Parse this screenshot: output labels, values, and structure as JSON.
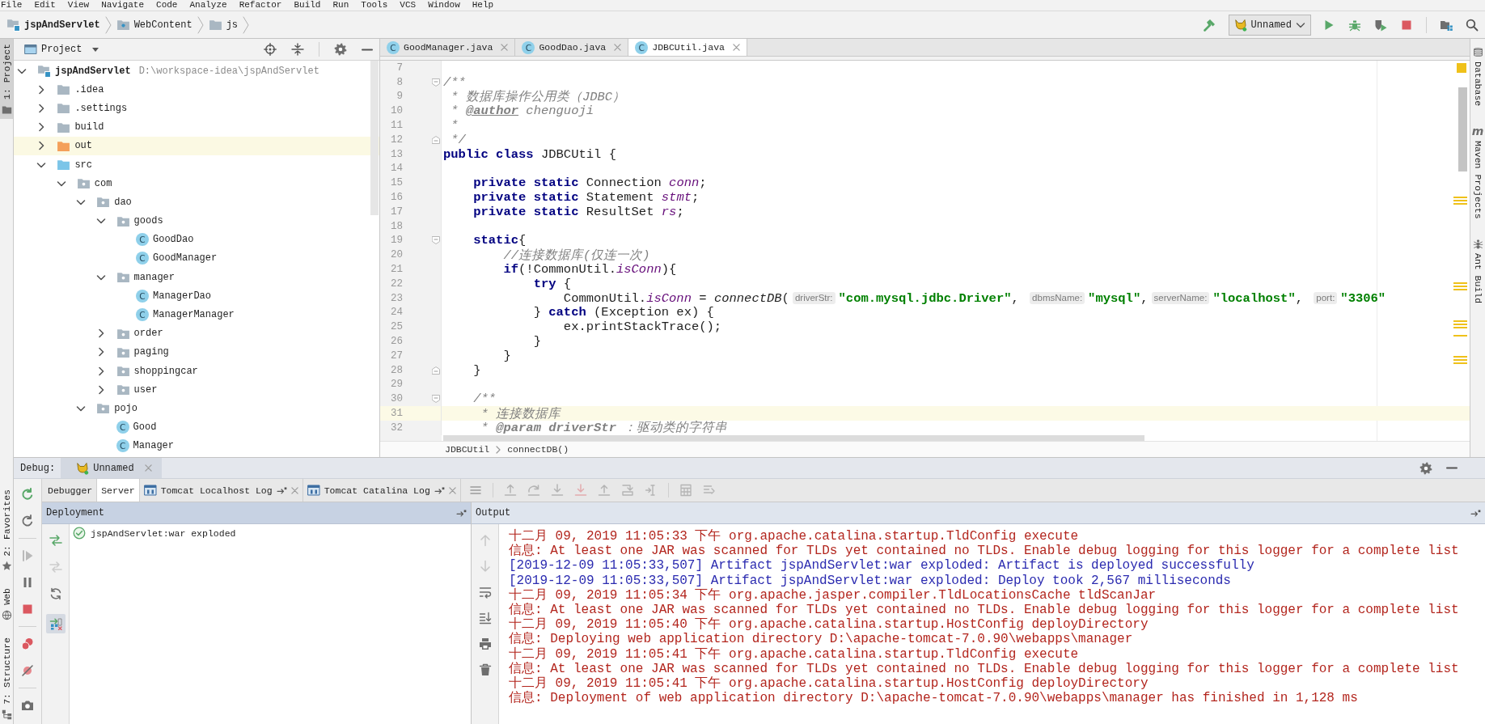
{
  "menu_bar": [
    "File",
    "Edit",
    "View",
    "Navigate",
    "Code",
    "Analyze",
    "Refactor",
    "Build",
    "Run",
    "Tools",
    "VCS",
    "Window",
    "Help"
  ],
  "nav_bar": {
    "breadcrumbs": [
      {
        "label": "jspAndServlet",
        "kind": "module"
      },
      {
        "label": "WebContent",
        "kind": "web_folder"
      },
      {
        "label": "js",
        "kind": "folder"
      }
    ],
    "run_config": {
      "label": "Unnamed"
    }
  },
  "left_tool_strip": {
    "top": [
      {
        "label": "1: Project",
        "kind": "project",
        "selected": true
      }
    ],
    "bottom": [
      {
        "label": "2: Favorites",
        "kind": "favorites",
        "selected": false
      },
      {
        "label": "Web",
        "kind": "web",
        "selected": false
      },
      {
        "label": "7: Structure",
        "kind": "structure",
        "selected": false
      }
    ]
  },
  "project": {
    "title": "Project",
    "tree": [
      {
        "label": "jspAndServlet",
        "location": "D:\\workspace-idea\\jspAndServlet",
        "kind": "module",
        "expanded": true,
        "selected": false,
        "children": [
          {
            "label": ".idea",
            "kind": "folder",
            "expanded": false,
            "selected": false
          },
          {
            "label": ".settings",
            "kind": "folder",
            "expanded": false,
            "selected": false
          },
          {
            "label": "build",
            "kind": "folder",
            "expanded": false,
            "selected": false
          },
          {
            "label": "out",
            "kind": "excluded_folder",
            "expanded": false,
            "selected": true
          },
          {
            "label": "src",
            "kind": "source_folder",
            "expanded": true,
            "selected": false,
            "children": [
              {
                "label": "com",
                "kind": "package",
                "expanded": true,
                "selected": false,
                "children": [
                  {
                    "label": "dao",
                    "kind": "package",
                    "expanded": true,
                    "selected": false,
                    "children": [
                      {
                        "label": "goods",
                        "kind": "package",
                        "expanded": true,
                        "selected": false,
                        "children": [
                          {
                            "label": "GoodDao",
                            "kind": "class",
                            "icon_letter": "C",
                            "expanded": false,
                            "selected": false
                          },
                          {
                            "label": "GoodManager",
                            "kind": "class",
                            "icon_letter": "C",
                            "expanded": false,
                            "selected": false
                          }
                        ]
                      },
                      {
                        "label": "manager",
                        "kind": "package",
                        "expanded": true,
                        "selected": false,
                        "children": [
                          {
                            "label": "ManagerDao",
                            "kind": "class",
                            "icon_letter": "C",
                            "expanded": false,
                            "selected": false
                          },
                          {
                            "label": "ManagerManager",
                            "kind": "class",
                            "icon_letter": "C",
                            "expanded": false,
                            "selected": false
                          }
                        ]
                      },
                      {
                        "label": "order",
                        "kind": "package",
                        "expanded": false,
                        "selected": false
                      },
                      {
                        "label": "paging",
                        "kind": "package",
                        "expanded": false,
                        "selected": false
                      },
                      {
                        "label": "shoppingcar",
                        "kind": "package",
                        "expanded": false,
                        "selected": false
                      },
                      {
                        "label": "user",
                        "kind": "package",
                        "expanded": false,
                        "selected": false
                      }
                    ]
                  },
                  {
                    "label": "pojo",
                    "kind": "package",
                    "expanded": true,
                    "selected": false,
                    "children": [
                      {
                        "label": "Good",
                        "kind": "class",
                        "icon_letter": "C",
                        "expanded": false,
                        "selected": false
                      },
                      {
                        "label": "Manager",
                        "kind": "class",
                        "icon_letter": "C",
                        "expanded": false,
                        "selected": false
                      }
                    ]
                  }
                ]
              }
            ]
          }
        ]
      }
    ]
  },
  "editor": {
    "tabs": [
      {
        "label": "GoodManager.java",
        "icon_letter": "C",
        "selected": false
      },
      {
        "label": "GoodDao.java",
        "icon_letter": "C",
        "selected": false
      },
      {
        "label": "JDBCUtil.java",
        "icon_letter": "C",
        "selected": true
      }
    ],
    "lines": [
      {
        "number": "7",
        "kind": "plain",
        "current": false
      },
      {
        "number": "8",
        "kind": "fold_start",
        "current": false,
        "tokens": [
          {
            "kind": "doc",
            "text": "/**"
          }
        ]
      },
      {
        "number": "9",
        "kind": "plain",
        "current": false,
        "tokens": [
          {
            "kind": "doc",
            "text": " * 数据库操作公用类（JDBC）"
          }
        ]
      },
      {
        "number": "10",
        "kind": "plain",
        "current": false,
        "tokens": [
          {
            "kind": "doc",
            "text": " * "
          },
          {
            "kind": "doc_tag",
            "text": "@author"
          },
          {
            "kind": "doc",
            "text": " chenguoji"
          }
        ]
      },
      {
        "number": "11",
        "kind": "plain",
        "current": false,
        "tokens": [
          {
            "kind": "doc",
            "text": " *"
          }
        ]
      },
      {
        "number": "12",
        "kind": "fold_end",
        "current": false,
        "tokens": [
          {
            "kind": "doc",
            "text": " */"
          }
        ]
      },
      {
        "number": "13",
        "kind": "plain",
        "current": false,
        "tokens": [
          {
            "kind": "keyword",
            "text": "public class"
          },
          {
            "kind": "plain",
            "text": " JDBCUtil {"
          }
        ]
      },
      {
        "number": "14",
        "kind": "plain",
        "current": false
      },
      {
        "number": "15",
        "kind": "plain",
        "current": false,
        "tokens": [
          {
            "kind": "keyword",
            "text": "    private static"
          },
          {
            "kind": "plain",
            "text": " Connection "
          },
          {
            "kind": "field",
            "text": "conn"
          },
          {
            "kind": "plain",
            "text": ";"
          }
        ]
      },
      {
        "number": "16",
        "kind": "plain",
        "current": false,
        "tokens": [
          {
            "kind": "keyword",
            "text": "    private static"
          },
          {
            "kind": "plain",
            "text": " Statement "
          },
          {
            "kind": "field",
            "text": "stmt"
          },
          {
            "kind": "plain",
            "text": ";"
          }
        ]
      },
      {
        "number": "17",
        "kind": "plain",
        "current": false,
        "tokens": [
          {
            "kind": "keyword",
            "text": "    private static"
          },
          {
            "kind": "plain",
            "text": " ResultSet "
          },
          {
            "kind": "field",
            "text": "rs"
          },
          {
            "kind": "plain",
            "text": ";"
          }
        ]
      },
      {
        "number": "18",
        "kind": "plain",
        "current": false
      },
      {
        "number": "19",
        "kind": "fold_start",
        "current": false,
        "tokens": [
          {
            "kind": "keyword",
            "text": "    static"
          },
          {
            "kind": "plain",
            "text": "{"
          }
        ]
      },
      {
        "number": "20",
        "kind": "plain",
        "current": false,
        "tokens": [
          {
            "kind": "comment",
            "text": "        //连接数据库(仅连一次)"
          }
        ]
      },
      {
        "number": "21",
        "kind": "plain",
        "current": false,
        "tokens": [
          {
            "kind": "keyword",
            "text": "        if"
          },
          {
            "kind": "plain",
            "text": "(!CommonUtil."
          },
          {
            "kind": "field",
            "text": "isConn"
          },
          {
            "kind": "plain",
            "text": "){"
          }
        ]
      },
      {
        "number": "22",
        "kind": "plain",
        "current": false,
        "tokens": [
          {
            "kind": "keyword",
            "text": "            try"
          },
          {
            "kind": "plain",
            "text": " {"
          }
        ]
      },
      {
        "number": "23",
        "kind": "plain",
        "current": false,
        "tokens": [
          {
            "kind": "plain",
            "text": "                CommonUtil."
          },
          {
            "kind": "field",
            "text": "isConn"
          },
          {
            "kind": "plain",
            "text": " = "
          },
          {
            "kind": "method",
            "text": "connectDB"
          },
          {
            "kind": "plain",
            "text": "("
          },
          {
            "kind": "hint",
            "text": "driverStr:"
          },
          {
            "kind": "string",
            "text": "\"com.mysql.jdbc.Driver\""
          },
          {
            "kind": "plain",
            "text": ", "
          },
          {
            "kind": "hint",
            "text": "dbmsName:"
          },
          {
            "kind": "string",
            "text": "\"mysql\""
          },
          {
            "kind": "plain",
            "text": ","
          },
          {
            "kind": "hint",
            "text": "serverName:"
          },
          {
            "kind": "string",
            "text": "\"localhost\""
          },
          {
            "kind": "plain",
            "text": ", "
          },
          {
            "kind": "hint",
            "text": "port:"
          },
          {
            "kind": "string",
            "text": "\"3306\""
          }
        ]
      },
      {
        "number": "24",
        "kind": "plain",
        "current": false,
        "tokens": [
          {
            "kind": "plain",
            "text": "            } "
          },
          {
            "kind": "keyword",
            "text": "catch"
          },
          {
            "kind": "plain",
            "text": " (Exception ex) {"
          }
        ]
      },
      {
        "number": "25",
        "kind": "plain",
        "current": false,
        "tokens": [
          {
            "kind": "plain",
            "text": "                ex.printStackTrace();"
          }
        ]
      },
      {
        "number": "26",
        "kind": "plain",
        "current": false,
        "tokens": [
          {
            "kind": "plain",
            "text": "            }"
          }
        ]
      },
      {
        "number": "27",
        "kind": "plain",
        "current": false,
        "tokens": [
          {
            "kind": "plain",
            "text": "        }"
          }
        ]
      },
      {
        "number": "28",
        "kind": "fold_end",
        "current": false,
        "tokens": [
          {
            "kind": "plain",
            "text": "    }"
          }
        ]
      },
      {
        "number": "29",
        "kind": "plain",
        "current": false
      },
      {
        "number": "30",
        "kind": "fold_start",
        "current": false,
        "tokens": [
          {
            "kind": "doc",
            "text": "    /**"
          }
        ]
      },
      {
        "number": "31",
        "kind": "plain",
        "current": true,
        "tokens": [
          {
            "kind": "doc",
            "text": "     * 连接数据库"
          }
        ]
      },
      {
        "number": "32",
        "kind": "plain",
        "current": false,
        "tokens": [
          {
            "kind": "doc",
            "text": "     * "
          },
          {
            "kind": "doc_param",
            "text": "@param driverStr"
          },
          {
            "kind": "doc",
            "text": " ：驱动类的字符串"
          }
        ]
      }
    ],
    "breadcrumbs": [
      "JDBCUtil",
      "connectDB()"
    ]
  },
  "right_tool_strip": [
    {
      "label": "Database",
      "kind": "database"
    },
    {
      "label": "Maven Projects",
      "kind": "maven",
      "icon_letter": "m"
    },
    {
      "label": "Ant Build",
      "kind": "ant"
    }
  ],
  "debug": {
    "title": "Debug:",
    "session": {
      "label": "Unnamed"
    },
    "actions": [
      [
        {
          "kind": "rerun",
          "disabled": false
        },
        {
          "kind": "update",
          "disabled": false
        }
      ],
      [
        {
          "kind": "resume",
          "disabled": true
        },
        {
          "kind": "pause",
          "disabled": false
        },
        {
          "kind": "stop",
          "disabled": false
        }
      ],
      [
        {
          "kind": "breakpoints",
          "disabled": false
        },
        {
          "kind": "mute",
          "disabled": false
        }
      ],
      [
        {
          "kind": "camera",
          "disabled": false
        }
      ]
    ],
    "tabs": [
      {
        "label": "Debugger",
        "kind": "view",
        "selected": false
      },
      {
        "label": "Server",
        "kind": "view",
        "selected": true
      },
      {
        "label": "Tomcat Localhost Log",
        "kind": "log",
        "selected": false
      },
      {
        "label": "Tomcat Catalina Log",
        "kind": "log",
        "selected": false
      }
    ],
    "toolbar": [
      [
        {
          "kind": "menu",
          "disabled": false
        }
      ],
      [
        {
          "kind": "execpoint",
          "disabled": true
        },
        {
          "kind": "stepover",
          "disabled": true
        },
        {
          "kind": "stepinto",
          "disabled": true
        },
        {
          "kind": "forcestepinto",
          "disabled": true
        },
        {
          "kind": "stepout",
          "disabled": true
        },
        {
          "kind": "dropframe",
          "disabled": true
        },
        {
          "kind": "runtocursor",
          "disabled": true
        }
      ],
      [
        {
          "kind": "evaluate",
          "disabled": true
        },
        {
          "kind": "trace",
          "disabled": true
        }
      ]
    ],
    "deployment": {
      "title": "Deployment",
      "tools": [
        {
          "kind": "deploy",
          "disabled": false,
          "pressed": false
        },
        {
          "kind": "undeploy",
          "disabled": true,
          "pressed": false
        },
        {
          "kind": "refresh",
          "disabled": false,
          "pressed": false
        },
        {
          "kind": "artifacts",
          "disabled": false,
          "pressed": true
        }
      ],
      "items": [
        {
          "label": "jspAndServlet:war exploded",
          "kind": "deployed"
        }
      ]
    },
    "output": {
      "title": "Output",
      "tools": [
        {
          "kind": "up",
          "disabled": true
        },
        {
          "kind": "down",
          "disabled": true
        },
        {
          "kind": "wrap",
          "disabled": false
        },
        {
          "kind": "autoscroll",
          "disabled": false
        },
        {
          "kind": "print",
          "disabled": false
        },
        {
          "kind": "trash",
          "disabled": false
        }
      ],
      "lines": [
        {
          "kind": "stderr",
          "text": "十二月 09, 2019 11:05:33 下午 org.apache.catalina.startup.TldConfig execute"
        },
        {
          "kind": "stderr",
          "text": "信息: At least one JAR was scanned for TLDs yet contained no TLDs. Enable debug logging for this logger for a complete list"
        },
        {
          "kind": "stdout",
          "text": "[2019-12-09 11:05:33,507] Artifact jspAndServlet:war exploded: Artifact is deployed successfully"
        },
        {
          "kind": "stdout",
          "text": "[2019-12-09 11:05:33,507] Artifact jspAndServlet:war exploded: Deploy took 2,567 milliseconds"
        },
        {
          "kind": "stderr",
          "text": "十二月 09, 2019 11:05:34 下午 org.apache.jasper.compiler.TldLocationsCache tldScanJar"
        },
        {
          "kind": "stderr",
          "text": "信息: At least one JAR was scanned for TLDs yet contained no TLDs. Enable debug logging for this logger for a complete list"
        },
        {
          "kind": "stderr",
          "text": "十二月 09, 2019 11:05:40 下午 org.apache.catalina.startup.HostConfig deployDirectory"
        },
        {
          "kind": "stderr",
          "text": "信息: Deploying web application directory D:\\apache-tomcat-7.0.90\\webapps\\manager"
        },
        {
          "kind": "stderr",
          "text": "十二月 09, 2019 11:05:41 下午 org.apache.catalina.startup.TldConfig execute"
        },
        {
          "kind": "stderr",
          "text": "信息: At least one JAR was scanned for TLDs yet contained no TLDs. Enable debug logging for this logger for a complete list"
        },
        {
          "kind": "stderr",
          "text": "十二月 09, 2019 11:05:41 下午 org.apache.catalina.startup.HostConfig deployDirectory"
        },
        {
          "kind": "stderr",
          "text": "信息: Deployment of web application directory D:\\apache-tomcat-7.0.90\\webapps\\manager has finished in 1,128 ms"
        }
      ]
    }
  }
}
